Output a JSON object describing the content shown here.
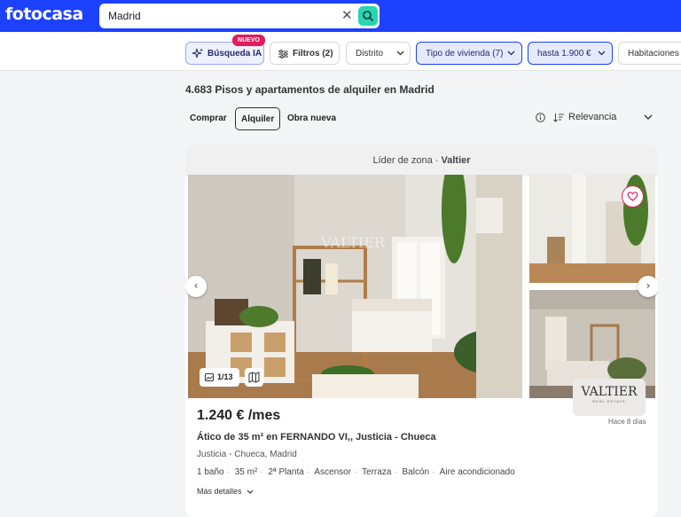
{
  "header": {
    "logo": "fotocasa",
    "search_value": "Madrid"
  },
  "filters": {
    "ai_search": "Búsqueda IA",
    "new_badge": "NUEVO",
    "filters": "Filtros (2)",
    "district": "Distrito",
    "property_type": "Tipo de vivienda (7)",
    "max_price": "hasta 1.900 €",
    "rooms": "Habitaciones"
  },
  "results": {
    "heading": "4.683 Pisos y apartamentos de alquiler en Madrid",
    "tabs": [
      "Comprar",
      "Alquiler",
      "Obra nueva"
    ],
    "active_tab": "Alquiler",
    "sort_label": "Relevancia"
  },
  "listing": {
    "zone_leader_prefix": "Líder de zona · ",
    "zone_leader_agency": "Valtier",
    "photo_counter": "1/13",
    "price": "1.240 € /mes",
    "title": "Ático de 35 m² en FERNANDO VI,, Justicia - Chueca",
    "location": "Justicia - Chueca, Madrid",
    "features": [
      "1 baño",
      "35 m²",
      "2ª Planta",
      "Ascensor",
      "Terraza",
      "Balcón",
      "Aire acondicionado"
    ],
    "more_details": "Más detalles",
    "posted": "Hace 8 días",
    "agency_logo_text": "VALTIER",
    "agency_logo_sub": "REAL ESTATE",
    "watermark": "VALTIER"
  },
  "colors": {
    "brand_blue": "#1c41ff",
    "search_teal": "#27d5b1",
    "badge_pink": "#e41b5c"
  }
}
